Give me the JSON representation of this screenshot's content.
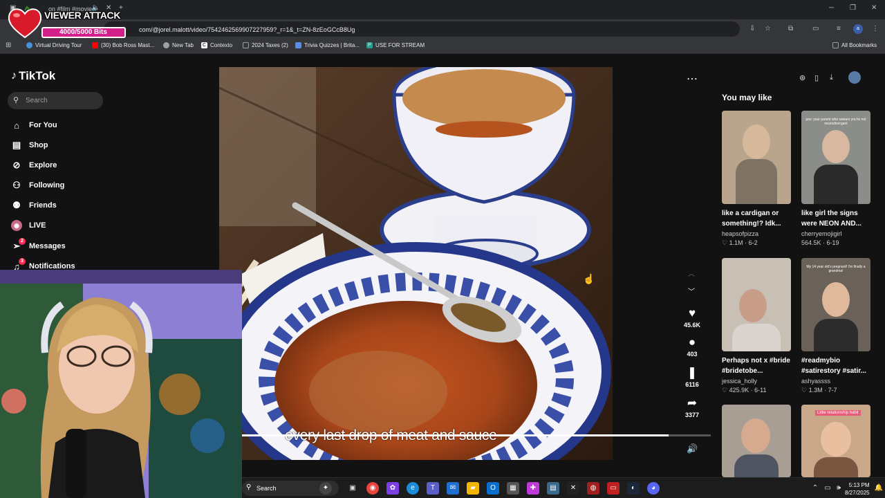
{
  "overlay": {
    "title": "VIEWER ATTACK",
    "bits": "4000/5000 Bits",
    "bits_progress": 0.8
  },
  "browser": {
    "tab_title": "on #film #movie #",
    "url": "com/@jorel.malott/video/7542462569907227959?_r=1&_t=ZN-8zEoGCcB8Ug",
    "bookmarks": [
      {
        "label": "Virtual Driving Tour",
        "icon": "globe-icon",
        "color": "#4a90d9"
      },
      {
        "label": "(30) Bob Ross Mast...",
        "icon": "youtube-icon",
        "color": "#ff0000"
      },
      {
        "label": "New Tab",
        "icon": "chrome-icon",
        "color": "#9aa0a6"
      },
      {
        "label": "Contexto",
        "icon": "contexto-icon",
        "color": "#ffffff"
      },
      {
        "label": "2024 Taxes (2)",
        "icon": "folder-icon",
        "color": "#9aa0a6"
      },
      {
        "label": "Trivia Quizzes | Brita...",
        "icon": "britannica-icon",
        "color": "#5a8de8"
      },
      {
        "label": "USE FOR STREAM",
        "icon": "p-icon",
        "color": "#2a9d8f"
      }
    ],
    "all_bookmarks": "All Bookmarks"
  },
  "sidebar": {
    "logo": "TikTok",
    "search_placeholder": "Search",
    "items": [
      {
        "label": "For You",
        "icon": "home-icon",
        "glyph": "⌂"
      },
      {
        "label": "Shop",
        "icon": "shop-bag-icon",
        "glyph": "🛍"
      },
      {
        "label": "Explore",
        "icon": "compass-icon",
        "glyph": "⊘"
      },
      {
        "label": "Following",
        "icon": "following-icon",
        "glyph": "⚇"
      },
      {
        "label": "Friends",
        "icon": "friends-icon",
        "glyph": "⚉"
      },
      {
        "label": "LIVE",
        "icon": "live-icon",
        "glyph": "◉"
      },
      {
        "label": "Messages",
        "icon": "send-icon",
        "glyph": "➢",
        "badge": "2"
      },
      {
        "label": "Notifications",
        "icon": "bell-icon",
        "glyph": "🔔",
        "badge": "3"
      }
    ]
  },
  "video": {
    "subtitle": "every last drop of meat and sauce",
    "progress": 0.91,
    "actions": [
      {
        "icon": "heart-icon",
        "glyph": "♥",
        "count": "45.6K"
      },
      {
        "icon": "comment-icon",
        "glyph": "●",
        "count": "403"
      },
      {
        "icon": "bookmark-icon",
        "glyph": "❚",
        "count": "6116"
      },
      {
        "icon": "share-icon",
        "glyph": "➦",
        "count": "3377"
      }
    ]
  },
  "right_panel": {
    "title": "You may like",
    "cards": [
      {
        "caption": "like a cardigan or something!? Idk...",
        "author": "heapsofpizza",
        "views": "1.1M",
        "date": "6-2",
        "overlay": "",
        "bg": "#b8a58c"
      },
      {
        "caption": "like girl the signs were NEON AND...",
        "author": "cherryemojigirl",
        "views": "564.5K",
        "date": "6-19",
        "overlay": "pov: your parent who swears you're not neurodivergent",
        "bg": "#8a8d88"
      },
      {
        "caption": "Perhaps not x #bride #bridetobe...",
        "author": "jessica_holly",
        "views": "425.9K",
        "date": "6-11",
        "overlay": "",
        "bg": "#c8c0b4"
      },
      {
        "caption": "#readmybio #satirestory #satir...",
        "author": "ashyassss",
        "views": "1.3M",
        "date": "7-7",
        "overlay": "My 14 year old's pregnant! I'm finally a grandma!",
        "bg": "#6a6258"
      },
      {
        "caption": "",
        "author": "",
        "views": "",
        "date": "",
        "overlay": "",
        "bg": "#a89e94"
      },
      {
        "caption": "",
        "author": "",
        "views": "",
        "date": "",
        "overlay": "Little relationship habit",
        "bg": "#c9a88a"
      }
    ]
  },
  "taskbar": {
    "search": "Search",
    "time": "5:13 PM",
    "date": "8/27/2025"
  }
}
